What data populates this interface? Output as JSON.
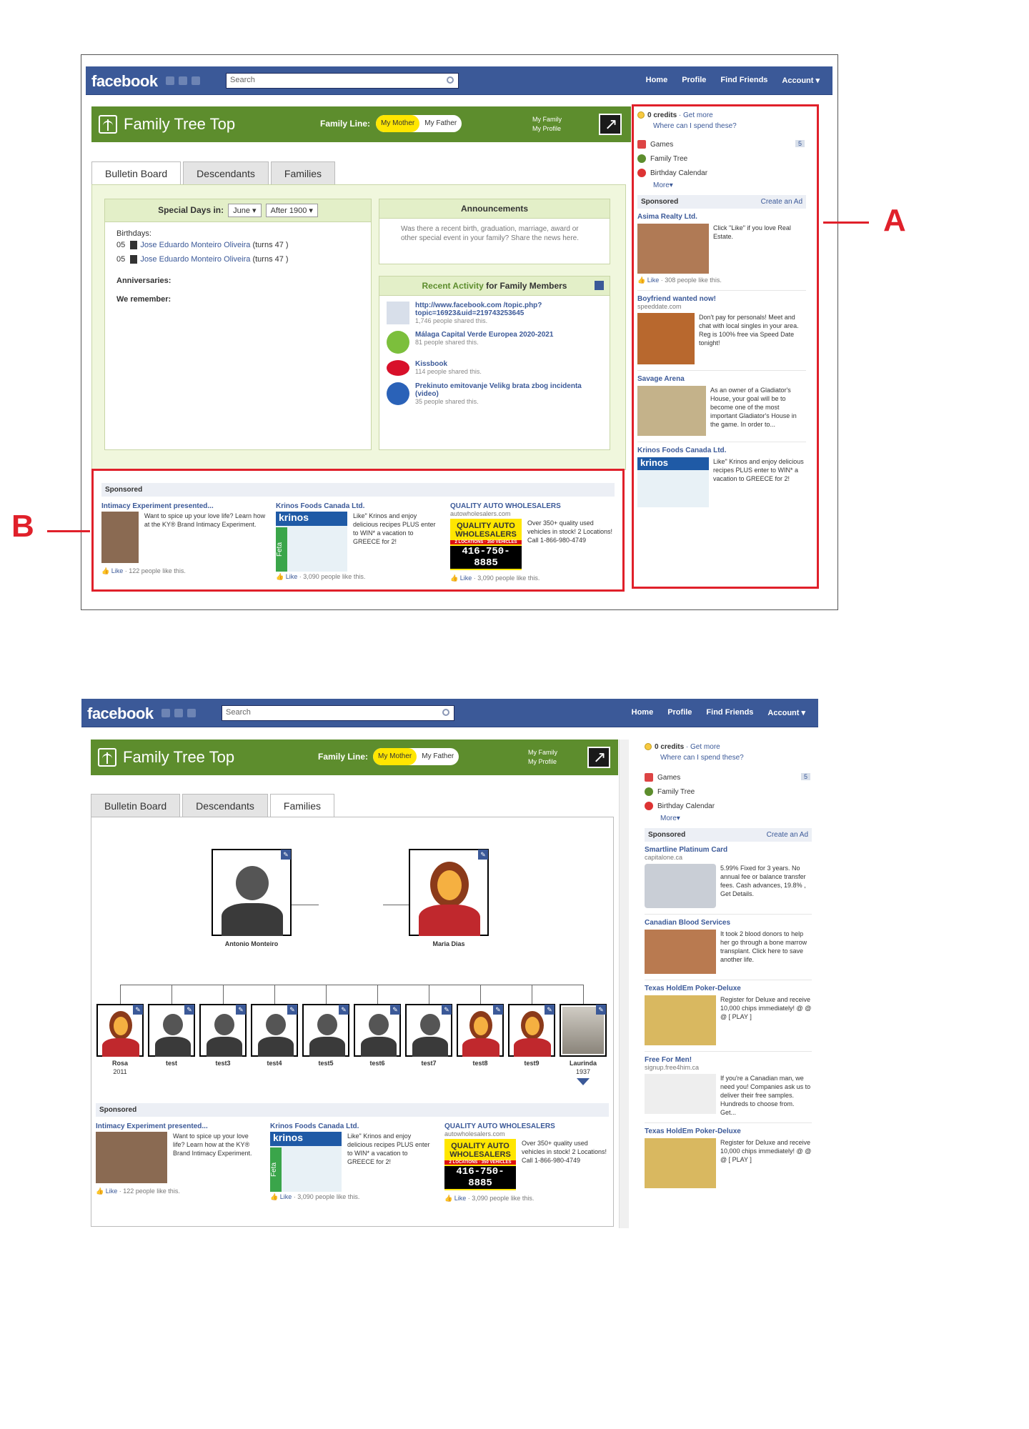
{
  "colors": {
    "fb_blue": "#3b5998",
    "green_header": "#5d8d2d",
    "red_annotation": "#e0202a",
    "mother_pill": "#ffe600"
  },
  "annotations": {
    "a": "A",
    "b": "B"
  },
  "fb": {
    "logo": "facebook",
    "search_placeholder": "Search",
    "nav": [
      "Home",
      "Profile",
      "Find Friends",
      "Account ▾"
    ]
  },
  "app": {
    "title": "Family Tree Top",
    "family_line_label": "Family Line:",
    "my_mother": "My Mother",
    "my_father": "My Father",
    "my_family": "My Family",
    "my_profile": "My Profile",
    "expand_icon": "expand-arrow-icon"
  },
  "tabs": [
    "Bulletin Board",
    "Descendants",
    "Families"
  ],
  "bulletin": {
    "special_days_label": "Special Days in:",
    "month": "June",
    "after": "After 1900",
    "birthdays_label": "Birthdays:",
    "birthdays": [
      {
        "day": "05",
        "name": "Jose Eduardo Monteiro Oliveira",
        "turns": "(turns 47 )"
      },
      {
        "day": "05",
        "name": "Jose Eduardo Monteiro Oliveira",
        "turns": "(turns 47 )"
      }
    ],
    "anniversaries_label": "Anniversaries:",
    "we_remember_label": "We remember:",
    "announcements_title": "Announcements",
    "announcements_text": "Was there a recent birth, graduation, marriage, award or other special event in your family? Share the news here.",
    "recent_title_a": "Recent Activity",
    "recent_title_b": "for Family Members",
    "activity": [
      {
        "title": "http://www.facebook.com /topic.php?topic=16923&uid=219743253645",
        "shared": "1,746 people shared this."
      },
      {
        "title": "Málaga Capital Verde Europea 2020-2021",
        "shared": "81 people shared this."
      },
      {
        "title": "Kissbook",
        "shared": "114 people shared this."
      },
      {
        "title": "Prekinuto emitovanje Velikg brata zbog incidenta (video)",
        "shared": "35 people shared this."
      }
    ]
  },
  "sponsored_label": "Sponsored",
  "create_ad": "Create an Ad",
  "bottom_ads": [
    {
      "title": "Intimacy Experiment presented...",
      "url": "",
      "body": "Want to spice up your love life? Learn how at the KY® Brand Intimacy Experiment.",
      "like": "Like",
      "likes": "· 122 people like this."
    },
    {
      "title": "Krinos Foods Canada Ltd.",
      "url": "",
      "body": "Like\" Krinos and enjoy delicious recipes PLUS enter to WIN* a vacation to GREECE for 2!",
      "like": "Like",
      "likes": "· 3,090 people like this."
    },
    {
      "title": "QUALITY AUTO WHOLESALERS",
      "url": "autowholesalers.com",
      "body": "Over 350+ quality used vehicles in stock! 2 Locations! Call 1-866-980-4749",
      "like": "Like",
      "likes": "· 3,090 people like this."
    }
  ],
  "auto_thumb": {
    "line1": "QUALITY AUTO",
    "line2": "WHOLESALERS",
    "line3": "2 LOCATIONS · 350 VEHICLES",
    "phone": "416-750-8885"
  },
  "krinos_thumb": {
    "brand": "krinos",
    "feta": "Feta"
  },
  "rightcol": {
    "credits": "0 credits",
    "get_more": "· Get more",
    "where": "Where can I spend these?",
    "apps": [
      {
        "name": "Games",
        "badge": "5"
      },
      {
        "name": "Family Tree",
        "badge": ""
      },
      {
        "name": "Birthday Calendar",
        "badge": ""
      }
    ],
    "more": "More▾"
  },
  "right_ads_top": [
    {
      "title": "Asima Realty Ltd.",
      "url": "",
      "body": "Click \"Like\" if you love Real Estate.",
      "like": "Like",
      "likes": "· 308 people like this."
    },
    {
      "title": "Boyfriend wanted now!",
      "url": "speeddate.com",
      "body": "Don't pay for personals! Meet and chat with local singles in your area. Reg is 100% free via Speed Date tonight!",
      "like": "",
      "likes": ""
    },
    {
      "title": "Savage Arena",
      "url": "",
      "body": "As an owner of a Gladiator's House, your goal will be to become one of the most important Gladiator's House in the game. In order to...",
      "like": "",
      "likes": ""
    },
    {
      "title": "Krinos Foods Canada Ltd.",
      "url": "",
      "body": "Like\" Krinos and enjoy delicious recipes PLUS enter to WIN* a vacation to GREECE for 2!",
      "like": "",
      "likes": ""
    }
  ],
  "right_ads_bottom": [
    {
      "title": "Smartline Platinum Card",
      "url": "capitalone.ca",
      "body": "5.99% Fixed for 3 years. No annual fee or balance transfer fees. Cash advances, 19.8% , Get Details."
    },
    {
      "title": "Canadian Blood Services",
      "url": "",
      "body": "It took 2 blood donors to help her go through a bone marrow transplant. Click here to save another life."
    },
    {
      "title": "Texas HoldEm Poker-Deluxe",
      "url": "",
      "body": "Register for Deluxe and receive 10,000 chips immediately! @ @ @ [ PLAY ]"
    },
    {
      "title": "Free For Men!",
      "url": "signup.free4him.ca",
      "body": "If you're a Canadian man, we need you! Companies ask us to deliver their free samples. Hundreds to choose from. Get..."
    },
    {
      "title": "Texas HoldEm Poker-Deluxe",
      "url": "",
      "body": "Register for Deluxe and receive 10,000 chips immediately! @ @ @ [ PLAY ]"
    }
  ],
  "families": {
    "father": "Antonio Monteiro",
    "mother": "Maria Dias",
    "children": [
      {
        "name": "Rosa",
        "year": "2011",
        "gender": "f"
      },
      {
        "name": "test",
        "year": "",
        "gender": "m"
      },
      {
        "name": "test3",
        "year": "",
        "gender": "m"
      },
      {
        "name": "test4",
        "year": "",
        "gender": "m"
      },
      {
        "name": "test5",
        "year": "",
        "gender": "m"
      },
      {
        "name": "test6",
        "year": "",
        "gender": "m"
      },
      {
        "name": "test7",
        "year": "",
        "gender": "m"
      },
      {
        "name": "test8",
        "year": "",
        "gender": "f"
      },
      {
        "name": "test9",
        "year": "",
        "gender": "f"
      },
      {
        "name": "Laurinda",
        "year": "1937",
        "gender": "photo"
      }
    ]
  }
}
